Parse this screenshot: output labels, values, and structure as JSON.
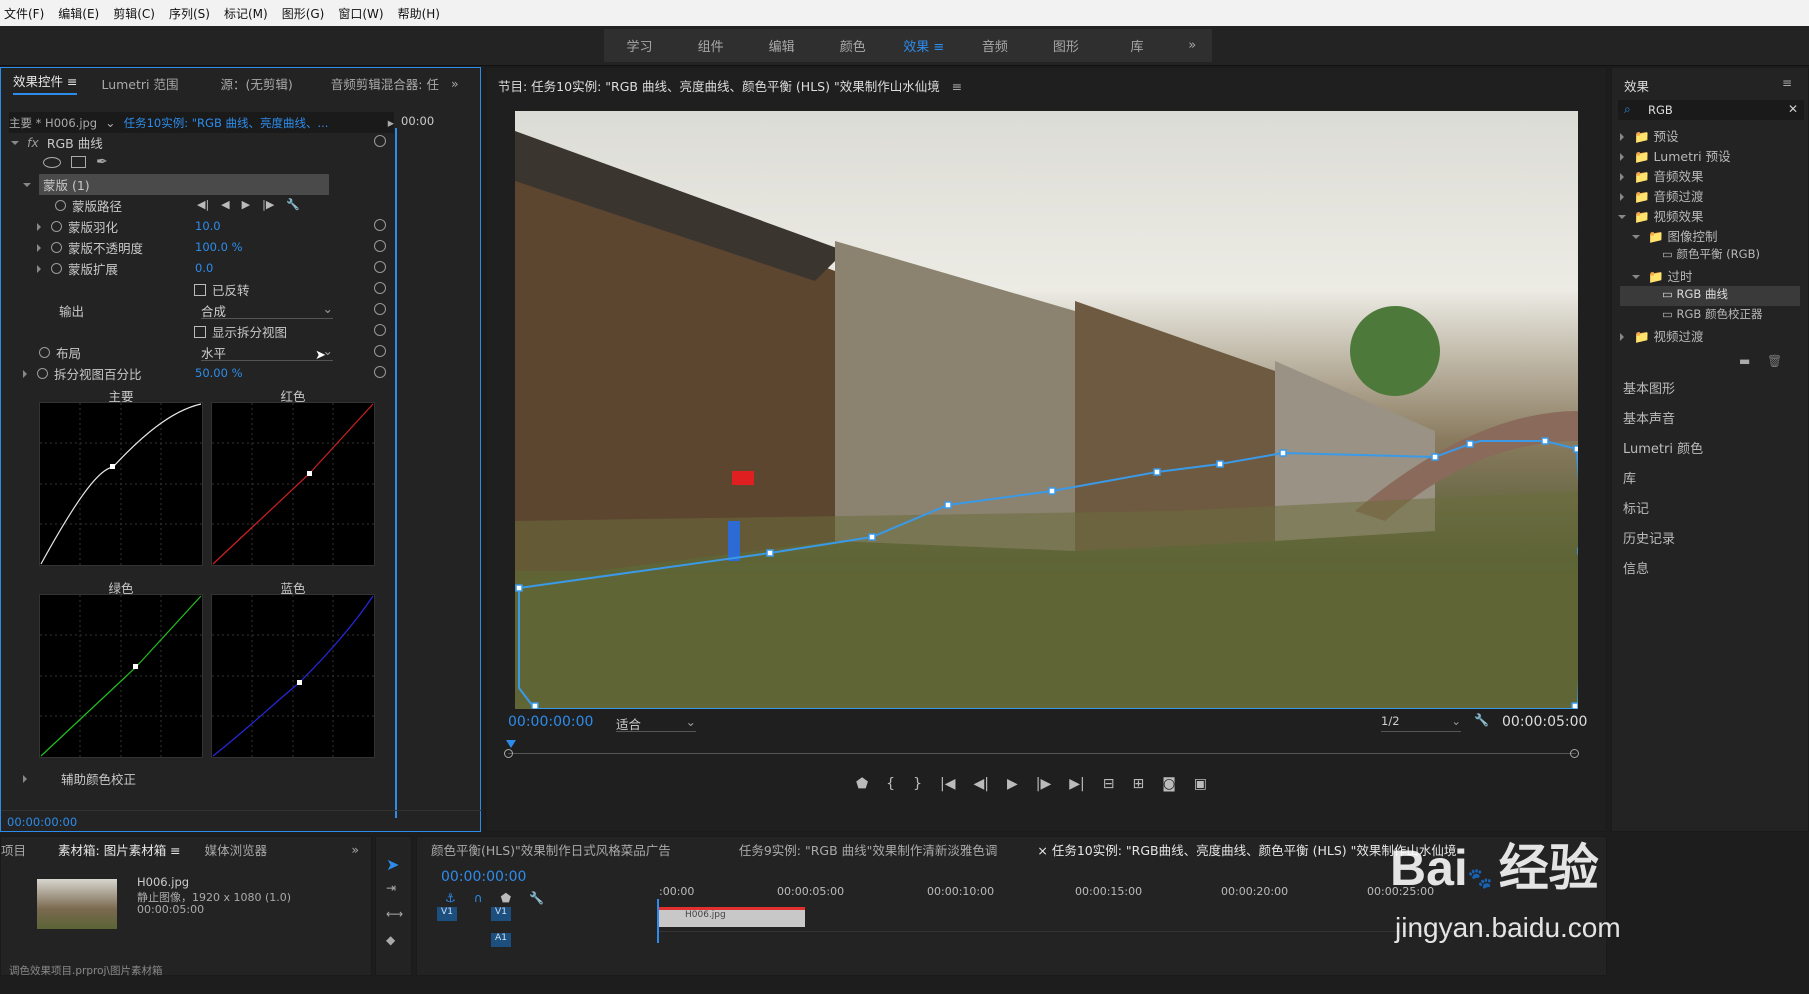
{
  "menu": [
    "文件(F)",
    "编辑(E)",
    "剪辑(C)",
    "序列(S)",
    "标记(M)",
    "图形(G)",
    "窗口(W)",
    "帮助(H)"
  ],
  "workspaces": [
    "学习",
    "组件",
    "编辑",
    "颜色",
    "效果",
    "音频",
    "图形",
    "库"
  ],
  "effect_controls": {
    "tabs": [
      "效果控件",
      "Lumetri 范围",
      "源：(无剪辑)",
      "音频剪辑混合器: 任"
    ],
    "clip_main": "主要 * H006.jpg",
    "clip_seq": "任务10实例: \"RGB 曲线、亮度曲线、...",
    "time_start": "00:00",
    "effect_name": "RGB 曲线",
    "mask_header": "蒙版 (1)",
    "mask_path": "蒙版路径",
    "feather_label": "蒙版羽化",
    "feather_val": "10.0",
    "opacity_label": "蒙版不透明度",
    "opacity_val": "100.0 %",
    "expand_label": "蒙版扩展",
    "expand_val": "0.0",
    "inverted": "已反转",
    "output_label": "输出",
    "output_val": "合成",
    "show_split": "显示拆分视图",
    "layout_label": "布局",
    "layout_val": "水平",
    "split_label": "拆分视图百分比",
    "split_val": "50.00 %",
    "curves": {
      "master": "主要",
      "red": "红色",
      "green": "绿色",
      "blue": "蓝色"
    },
    "secondary": "辅助颜色校正",
    "timecode": "00:00:00:00"
  },
  "program": {
    "title": "节目: 任务10实例: \"RGB 曲线、亮度曲线、颜色平衡 (HLS) \"效果制作山水仙境",
    "timecode": "00:00:00:00",
    "fit": "适合",
    "quality": "1/2",
    "duration": "00:00:05:00"
  },
  "effects_panel": {
    "title": "效果",
    "search": "RGB",
    "tree": [
      "预设",
      "Lumetri 预设",
      "音频效果",
      "音频过渡",
      "视频效果",
      "图像控制",
      "颜色平衡 (RGB)",
      "过时",
      "RGB 曲线",
      "RGB 颜色校正器",
      "视频过渡"
    ]
  },
  "side_panels": [
    "基本图形",
    "基本声音",
    "Lumetri 颜色",
    "库",
    "标记",
    "历史记录",
    "信息"
  ],
  "project": {
    "tabs": [
      "项目",
      "素材箱: 图片素材箱",
      "媒体浏览器"
    ],
    "clip_name": "H006.jpg",
    "clip_info": "静止图像，1920 x 1080 (1.0)",
    "clip_dur": "00:00:05:00",
    "bottom": "调色效果项目.prproj\\图片素材箱"
  },
  "timeline": {
    "tabs": [
      "颜色平衡(HLS)\"效果制作日式风格菜品广告",
      "任务9实例: \"RGB 曲线\"效果制作清新淡雅色调",
      "任务10实例: \"RGB曲线、亮度曲线、颜色平衡 (HLS) \"效果制作山水仙境"
    ],
    "timecode": "00:00:00:00",
    "ruler": [
      ":00:00",
      "00:00:05:00",
      "00:00:10:00",
      "00:00:15:00",
      "00:00:20:00",
      "00:00:25:00"
    ],
    "v1": "V1",
    "a1": "A1",
    "clip": "H006.jpg"
  },
  "watermark": {
    "brand": "Bai",
    "brand2": "经验",
    "url": "jingyan.baidu.com"
  },
  "colors": {
    "accent": "#2d8ceb",
    "panel": "#232323",
    "mask": "#3a9ae8"
  }
}
